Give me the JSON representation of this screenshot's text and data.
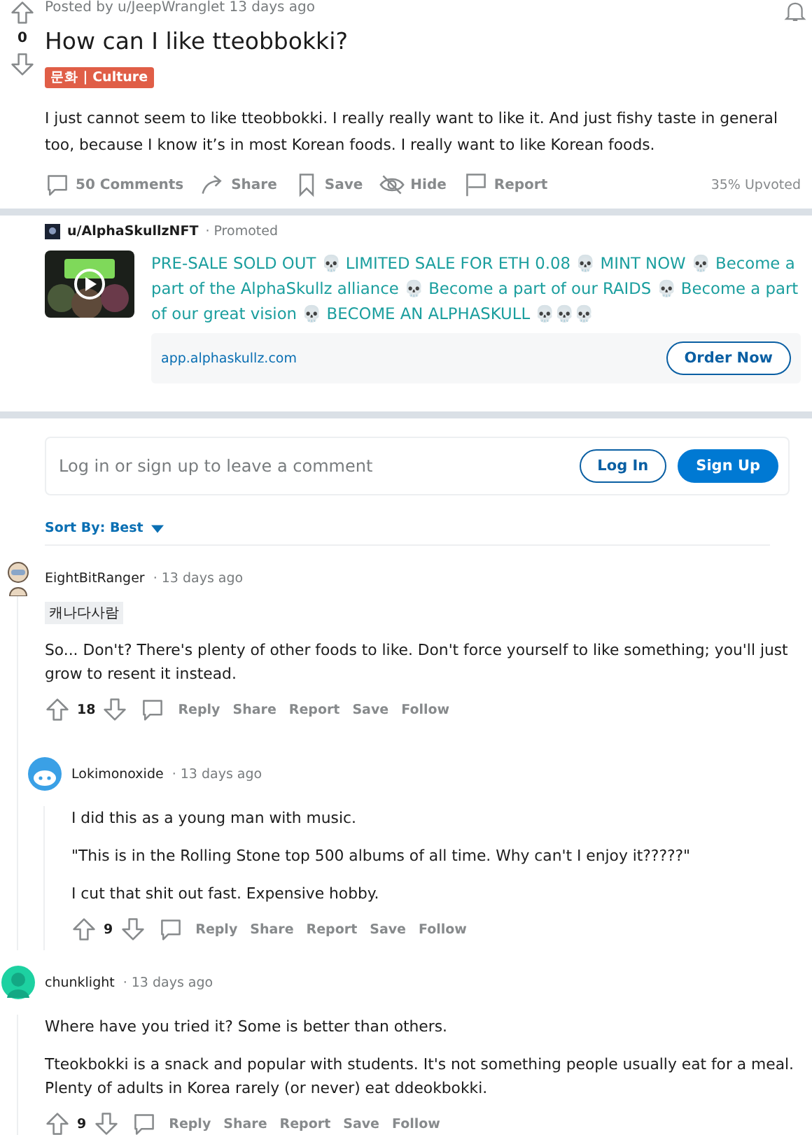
{
  "post": {
    "byline": "Posted by u/JeepWranglet 13 days ago",
    "score": "0",
    "title": "How can I like tteobbokki?",
    "flair": "문화 | Culture",
    "body": "I just cannot seem to like tteobbokki. I really really want to like it. And just fishy taste in general too, because I know it’s in most Korean foods. I really want to like Korean foods.",
    "actions": [
      {
        "kind": "comments",
        "label": "50 Comments"
      },
      {
        "kind": "share",
        "label": "Share"
      },
      {
        "kind": "save",
        "label": "Save"
      },
      {
        "kind": "hide",
        "label": "Hide"
      },
      {
        "kind": "report",
        "label": "Report"
      }
    ],
    "upvoted": "35% Upvoted"
  },
  "ad": {
    "user": "u/AlphaSkullzNFT",
    "promoted": "· Promoted",
    "text": "PRE-SALE SOLD OUT 💀 LIMITED SALE FOR ETH 0.08 💀 MINT NOW 💀 Become a part of the AlphaSkullz alliance 💀 Become a part of our RAIDS 💀 Become a part of our great vision 💀 BECOME AN ALPHASKULL 💀💀💀",
    "link": "app.alphaskullz.com",
    "button": "Order Now"
  },
  "comment_box": {
    "placeholder": "Log in or sign up to leave a comment",
    "login": "Log In",
    "signup": "Sign Up"
  },
  "sort": {
    "label": "Sort By: Best"
  },
  "comments": [
    {
      "author": "EightBitRanger",
      "time": "· 13 days ago",
      "flair": "캐나다사람",
      "avatar": {
        "kind": "robot"
      },
      "paragraphs": [
        "So... Don't? There's plenty of other foods to like. Don't force yourself to like something; you'll just grow to resent it instead."
      ],
      "score": "18",
      "actions": [
        "Reply",
        "Share",
        "Report",
        "Save",
        "Follow"
      ],
      "children": [
        {
          "author": "Lokimonoxide",
          "time": "· 13 days ago",
          "avatar": {
            "kind": "blue"
          },
          "paragraphs": [
            "I did this as a young man with music.",
            "\"This is in the Rolling Stone top 500 albums of all time. Why can't I enjoy it?????\"",
            "I cut that shit out fast. Expensive hobby."
          ],
          "score": "9",
          "actions": [
            "Reply",
            "Share",
            "Report",
            "Save",
            "Follow"
          ]
        }
      ]
    },
    {
      "author": "chunklight",
      "time": "· 13 days ago",
      "avatar": {
        "kind": "teal"
      },
      "paragraphs": [
        "Where have you tried it? Some is better than others.",
        "Tteokbokki is a snack and popular with students. It's not something people usually eat for a meal. Plenty of adults in Korea rarely (or never) eat ddeokbokki."
      ],
      "score": "9",
      "actions": [
        "Reply",
        "Share",
        "Report",
        "Save",
        "Follow"
      ]
    }
  ]
}
